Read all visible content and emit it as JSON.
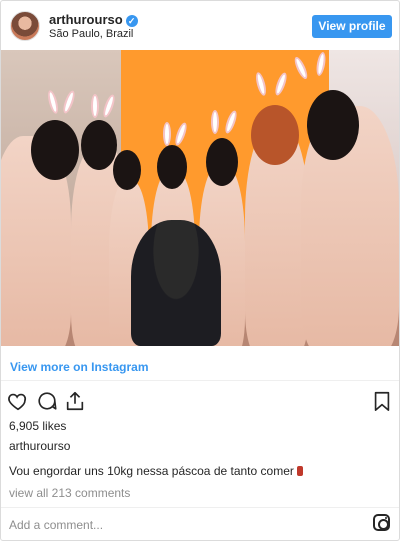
{
  "header": {
    "username": "arthurourso",
    "location": "São Paulo, Brazil",
    "verified_icon": "verified-badge-icon",
    "view_profile_label": "View profile",
    "accent_color": "#3897f0"
  },
  "post": {
    "view_more_label": "View more on Instagram",
    "likes": "6,905 likes",
    "author": "arthurourso",
    "caption": "Vou engordar uns 10kg nessa páscoa de tanto comer",
    "view_comments": "view all 213 comments",
    "add_comment_placeholder": "Add a comment..."
  },
  "icons": {
    "like": "heart-icon",
    "comment": "comment-bubble-icon",
    "share": "share-upload-icon",
    "save": "bookmark-icon",
    "instagram": "instagram-logo-icon"
  }
}
